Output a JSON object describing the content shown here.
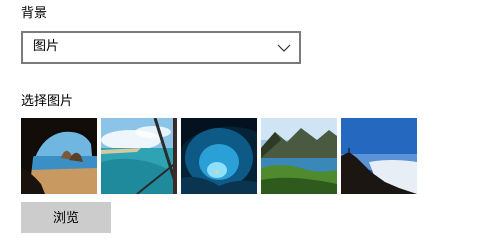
{
  "background": {
    "label": "背景",
    "selected_value": "图片",
    "dropdown_icon": "chevron-down-icon"
  },
  "picture_picker": {
    "label": "选择图片",
    "thumbnails": [
      {
        "name": "cave-beach-thumbnail"
      },
      {
        "name": "tropical-lagoon-thumbnail"
      },
      {
        "name": "ice-cave-thumbnail"
      },
      {
        "name": "mountain-lake-thumbnail"
      },
      {
        "name": "cliff-sea-of-clouds-thumbnail"
      }
    ]
  },
  "browse_button": {
    "label": "浏览"
  },
  "colors": {
    "button_bg": "#cccccc",
    "dropdown_border": "#7a7a7a"
  }
}
